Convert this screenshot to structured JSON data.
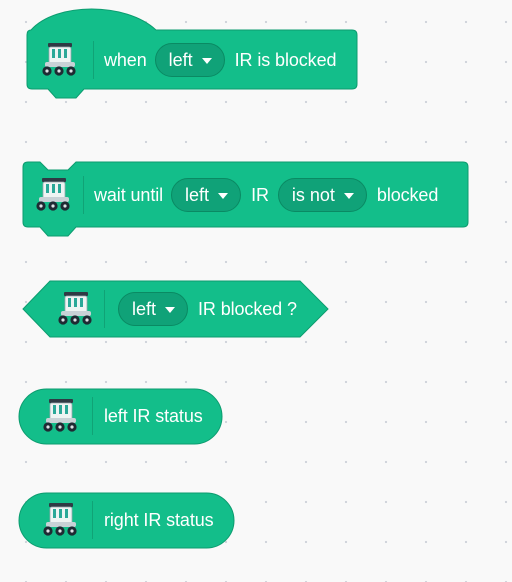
{
  "colors": {
    "block_fill": "#13be8a",
    "block_border": "#0c9c6f",
    "dropdown_fill": "#10a278",
    "text": "#ffffff",
    "workspace_bg": "#f9f9f9"
  },
  "blocks": [
    {
      "kind": "hat",
      "icon": "robot-car-icon",
      "parts": [
        {
          "type": "text",
          "value": "when"
        },
        {
          "type": "dropdown",
          "value": "left"
        },
        {
          "type": "text",
          "value": "IR is blocked"
        }
      ]
    },
    {
      "kind": "stack",
      "icon": "robot-car-icon",
      "parts": [
        {
          "type": "text",
          "value": "wait until"
        },
        {
          "type": "dropdown",
          "value": "left"
        },
        {
          "type": "text",
          "value": "IR"
        },
        {
          "type": "dropdown",
          "value": "is not"
        },
        {
          "type": "text",
          "value": "blocked"
        }
      ]
    },
    {
      "kind": "boolean",
      "icon": "robot-car-icon",
      "parts": [
        {
          "type": "dropdown",
          "value": "left"
        },
        {
          "type": "text",
          "value": "IR blocked ?"
        }
      ]
    },
    {
      "kind": "reporter",
      "icon": "robot-car-icon",
      "parts": [
        {
          "type": "text",
          "value": "left IR status"
        }
      ]
    },
    {
      "kind": "reporter",
      "icon": "robot-car-icon",
      "parts": [
        {
          "type": "text",
          "value": "right IR status"
        }
      ]
    }
  ]
}
